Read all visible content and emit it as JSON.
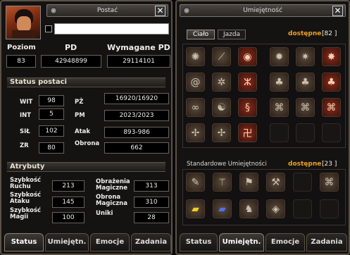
{
  "left_window": {
    "title": "Postać",
    "name_value": ""
  },
  "stats": {
    "level_label": "Poziom",
    "level": "83",
    "pd_label": "PD",
    "pd": "42948899",
    "req_label": "Wymagane PD",
    "req": "29114101"
  },
  "status": {
    "header": "Status postaci",
    "wit_label": "WIT",
    "wit": "98",
    "int_label": "INT",
    "int": "5",
    "sil_label": "SIŁ",
    "sil": "102",
    "zr_label": "ZR",
    "zr": "80",
    "pz_label": "PŻ",
    "pz": "16920/16920",
    "pm_label": "PM",
    "pm": "2023/2023",
    "atak_label": "Atak",
    "atak": "893-986",
    "obrona_label": "Obrona",
    "obrona": "662"
  },
  "attributes": {
    "header": "Atrybuty",
    "ruch_label": "Szybkość Ruchu",
    "ruch": "213",
    "atak_label": "Szybkość Ataku",
    "atak": "145",
    "magia_label": "Szybkość Magii",
    "magia": "100",
    "obr_mag_label": "Obrażenia Magiczne",
    "obr_mag": "313",
    "obrona_mag_label": "Obrona Magiczna",
    "obrona_mag": "310",
    "uniki_label": "Uniki",
    "uniki": "28"
  },
  "left_tabs": [
    "Status",
    "Umiejętn.",
    "Emocje",
    "Zadania"
  ],
  "right_window": {
    "title": "Umiejętność",
    "tab_body": "Ciało",
    "tab_ride": "Jazda",
    "available_label": "dostępne",
    "available_value": "[82 ]",
    "standard_label": "Standardowe Umiejętności",
    "standard_available_label": "dostępne",
    "standard_available_value": "[23 ]"
  },
  "right_tabs": [
    "Status",
    "Umiejętn.",
    "Emocje",
    "Zadania"
  ],
  "skill_icons": [
    "sword-swirl-icon",
    "slash-icon",
    "fire-orb-icon",
    "star-burst-icon",
    "ice-star-icon",
    "flame-star-icon",
    "spiral-icon",
    "cog-icon",
    "dragon-icon",
    "tree-icon",
    "tree-icon",
    "tree-red-icon",
    "swirl-icon",
    "yin-yang-icon",
    "serpent-icon",
    "knot-icon",
    "knot-icon",
    "knot-red-icon",
    "shuriken-icon",
    "shuriken-icon",
    "rune-icon"
  ],
  "standard_icons": [
    "brush-icon",
    "broom-icon",
    "flag-icon",
    "pickaxe-icon",
    "empty",
    "knot-icon",
    "yellow-book-icon",
    "blue-book-icon",
    "seahorse-icon",
    "shield-spiral-icon",
    "empty",
    "empty"
  ]
}
